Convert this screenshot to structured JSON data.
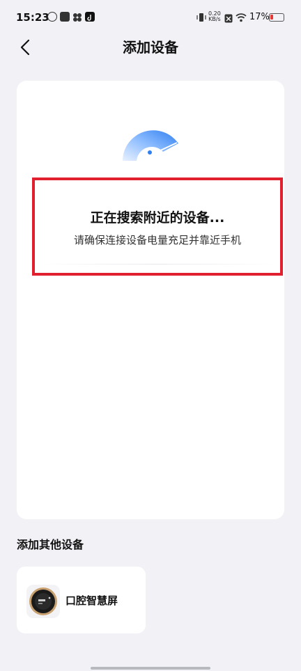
{
  "status_bar": {
    "time": "15:23",
    "net_speed_value": "0.20",
    "net_speed_unit": "KB/s",
    "battery_pct": "17%"
  },
  "header": {
    "title": "添加设备"
  },
  "search": {
    "title": "正在搜索附近的设备...",
    "subtitle": "请确保连接设备电量充足并靠近手机"
  },
  "other_devices": {
    "label": "添加其他设备",
    "items": [
      {
        "name": "口腔智慧屏",
        "icon": "oral-smart-screen-icon"
      }
    ]
  },
  "colors": {
    "background": "#f1f1f6",
    "card": "#ffffff",
    "accent": "#2f7ff0",
    "highlight": "#e0202f"
  }
}
